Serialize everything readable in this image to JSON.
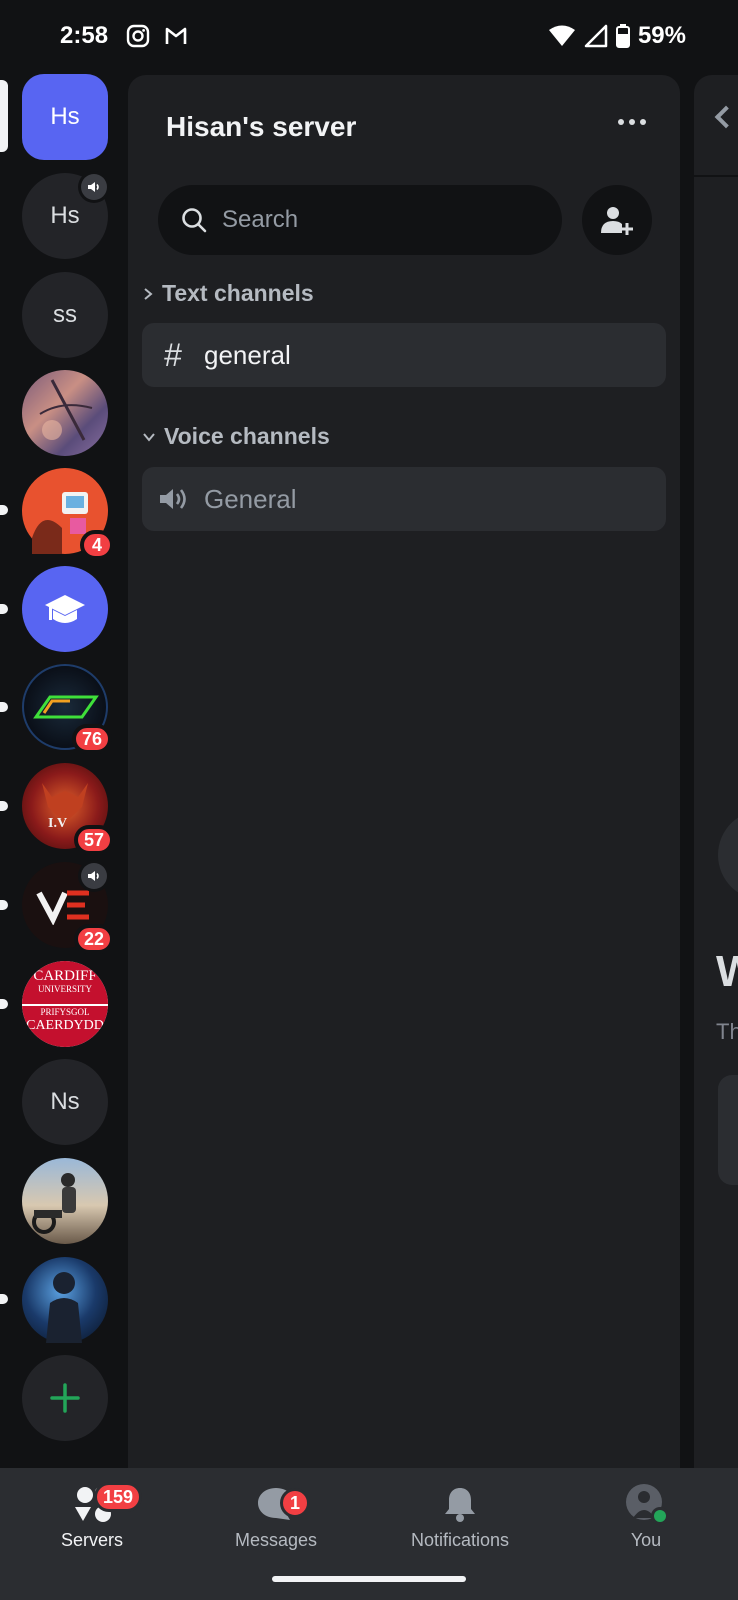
{
  "status_bar": {
    "time": "2:58",
    "battery": "59%"
  },
  "server_rail": {
    "servers": [
      {
        "initials": "Hs",
        "active": true
      },
      {
        "initials": "Hs"
      },
      {
        "initials": "ss"
      },
      {
        "badge": ""
      },
      {
        "badge": "4"
      },
      {
        "badge": ""
      },
      {
        "badge": "76"
      },
      {
        "badge": "57"
      },
      {
        "badge": "22"
      },
      {
        "badge": ""
      },
      {
        "initials": "Ns"
      },
      {
        "badge": ""
      },
      {
        "badge": ""
      }
    ],
    "cardiff_lines": [
      "CARDIFF",
      "UNIVERSITY",
      "PRIFYSGOL",
      "CAERDYDD"
    ]
  },
  "channel_panel": {
    "server_name": "Hisan's server",
    "search_placeholder": "Search",
    "categories": [
      {
        "label": "Text channels",
        "channels": [
          {
            "name": "general"
          }
        ]
      },
      {
        "label": "Voice channels",
        "channels": [
          {
            "name": "General"
          }
        ]
      }
    ]
  },
  "right_peek": {
    "big_text": "W",
    "small_text": "Th"
  },
  "bottom_nav": {
    "items": [
      {
        "label": "Servers",
        "badge": "159"
      },
      {
        "label": "Messages",
        "badge": "1"
      },
      {
        "label": "Notifications"
      },
      {
        "label": "You"
      }
    ]
  },
  "colors": {
    "accent": "#5865f2",
    "badge": "#f23f43",
    "online": "#23a559",
    "add_green": "#23a559"
  }
}
